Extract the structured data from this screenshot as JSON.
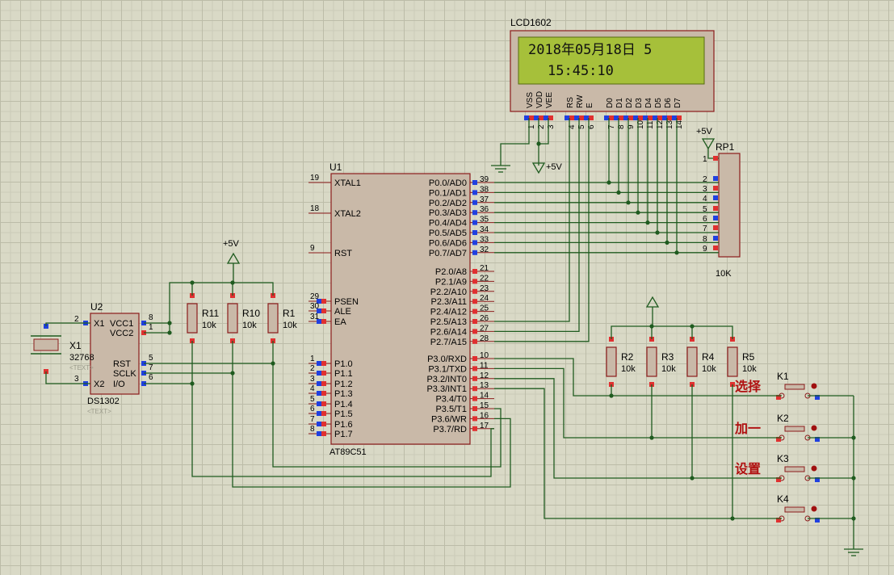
{
  "colors": {
    "wire": "#1f5b1f",
    "body": "#c9b9a8",
    "border": "#8b1b1b",
    "lcd_screen": "#a6c03a",
    "pin_red": "#e03030",
    "pin_blue": "#2040e0",
    "chinese_label": "#b01010"
  },
  "lcd": {
    "name": "LCD1602",
    "line1": "2018年05月18日  5",
    "line2": "15:45:10",
    "pin_labels": [
      "VSS",
      "VDD",
      "VEE",
      "RS",
      "RW",
      "E",
      "D0",
      "D1",
      "D2",
      "D3",
      "D4",
      "D5",
      "D6",
      "D7"
    ],
    "pin_numbers": [
      "1",
      "2",
      "3",
      "4",
      "5",
      "6",
      "7",
      "8",
      "9",
      "10",
      "11",
      "12",
      "13",
      "14"
    ]
  },
  "power": {
    "vcc": "+5V"
  },
  "u1": {
    "ref": "U1",
    "part": "AT89C51",
    "left_pins": [
      {
        "num": "19",
        "name": "XTAL1"
      },
      {
        "num": "18",
        "name": "XTAL2"
      },
      {
        "num": "9",
        "name": "RST"
      },
      {
        "num": "29",
        "name": "PSEN"
      },
      {
        "num": "30",
        "name": "ALE"
      },
      {
        "num": "31",
        "name": "EA"
      },
      {
        "num": "1",
        "name": "P1.0"
      },
      {
        "num": "2",
        "name": "P1.1"
      },
      {
        "num": "3",
        "name": "P1.2"
      },
      {
        "num": "4",
        "name": "P1.3"
      },
      {
        "num": "5",
        "name": "P1.4"
      },
      {
        "num": "6",
        "name": "P1.5"
      },
      {
        "num": "7",
        "name": "P1.6"
      },
      {
        "num": "8",
        "name": "P1.7"
      }
    ],
    "right_pins": [
      {
        "num": "39",
        "name": "P0.0/AD0"
      },
      {
        "num": "38",
        "name": "P0.1/AD1"
      },
      {
        "num": "37",
        "name": "P0.2/AD2"
      },
      {
        "num": "36",
        "name": "P0.3/AD3"
      },
      {
        "num": "35",
        "name": "P0.4/AD4"
      },
      {
        "num": "34",
        "name": "P0.5/AD5"
      },
      {
        "num": "33",
        "name": "P0.6/AD6"
      },
      {
        "num": "32",
        "name": "P0.7/AD7"
      },
      {
        "num": "21",
        "name": "P2.0/A8"
      },
      {
        "num": "22",
        "name": "P2.1/A9"
      },
      {
        "num": "23",
        "name": "P2.2/A10"
      },
      {
        "num": "24",
        "name": "P2.3/A11"
      },
      {
        "num": "25",
        "name": "P2.4/A12"
      },
      {
        "num": "26",
        "name": "P2.5/A13"
      },
      {
        "num": "27",
        "name": "P2.6/A14"
      },
      {
        "num": "28",
        "name": "P2.7/A15"
      },
      {
        "num": "10",
        "name": "P3.0/RXD"
      },
      {
        "num": "11",
        "name": "P3.1/TXD"
      },
      {
        "num": "12",
        "name": "P3.2/INT0"
      },
      {
        "num": "13",
        "name": "P3.3/INT1"
      },
      {
        "num": "14",
        "name": "P3.4/T0"
      },
      {
        "num": "15",
        "name": "P3.5/T1"
      },
      {
        "num": "16",
        "name": "P3.6/WR"
      },
      {
        "num": "17",
        "name": "P3.7/RD"
      }
    ]
  },
  "u2": {
    "ref": "U2",
    "part": "DS1302",
    "text_tag": "<TEXT>",
    "pins": [
      {
        "num": "2",
        "name": "X1"
      },
      {
        "num": "3",
        "name": "X2"
      },
      {
        "num": "8",
        "name": "VCC1"
      },
      {
        "num": "1",
        "name": "VCC2"
      },
      {
        "num": "5",
        "name": "RST"
      },
      {
        "num": "7",
        "name": "SCLK"
      },
      {
        "num": "6",
        "name": "I/O"
      }
    ]
  },
  "x1": {
    "ref": "X1",
    "value": "32768",
    "text_tag": "<TEXT>"
  },
  "rp1": {
    "ref": "RP1",
    "value": "10K",
    "pins": [
      "1",
      "2",
      "3",
      "4",
      "5",
      "6",
      "7",
      "8",
      "9"
    ]
  },
  "resistors": [
    {
      "ref": "R11",
      "value": "10k"
    },
    {
      "ref": "R10",
      "value": "10k"
    },
    {
      "ref": "R1",
      "value": "10k"
    },
    {
      "ref": "R2",
      "value": "10k"
    },
    {
      "ref": "R3",
      "value": "10k"
    },
    {
      "ref": "R4",
      "value": "10k"
    },
    {
      "ref": "R5",
      "value": "10k"
    }
  ],
  "keys": [
    {
      "ref": "K1",
      "label": "选择"
    },
    {
      "ref": "K2",
      "label": "加一"
    },
    {
      "ref": "K3",
      "label": "设置"
    },
    {
      "ref": "K4",
      "label": ""
    }
  ]
}
